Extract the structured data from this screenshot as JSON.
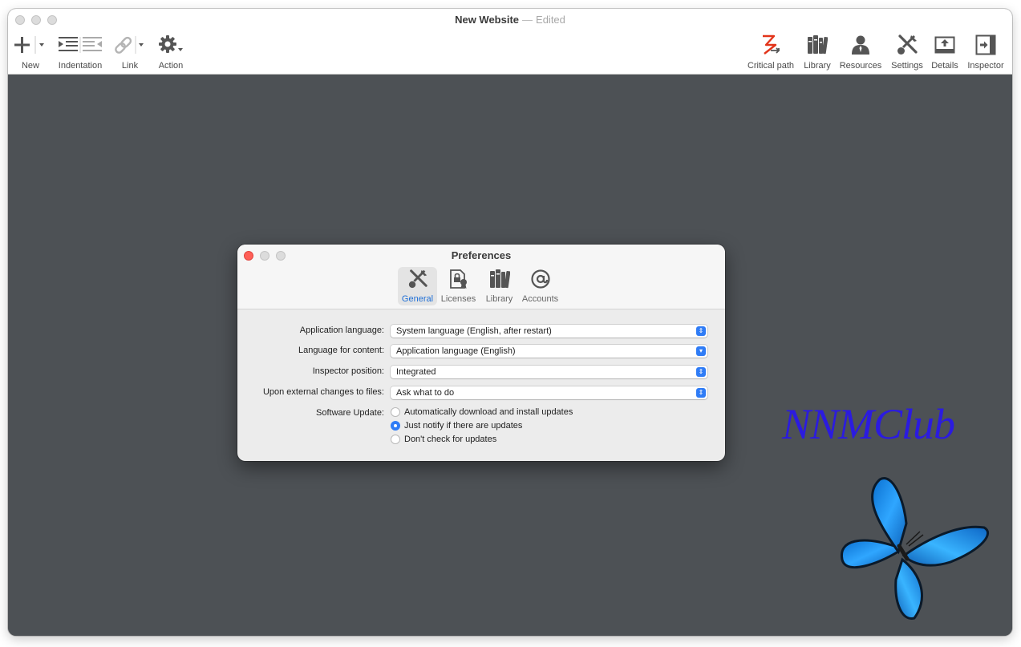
{
  "window": {
    "title": "New Website",
    "separator": "—",
    "status": "Edited"
  },
  "toolbar": {
    "left": [
      {
        "label": "New",
        "icon": "plus-icon"
      },
      {
        "label": "Indentation",
        "icon": "indentation-icon"
      },
      {
        "label": "Link",
        "icon": "link-icon"
      },
      {
        "label": "Action",
        "icon": "gear-icon"
      }
    ],
    "right": [
      {
        "label": "Critical path",
        "icon": "critical-path-icon"
      },
      {
        "label": "Library",
        "icon": "library-icon"
      },
      {
        "label": "Resources",
        "icon": "resources-icon"
      },
      {
        "label": "Settings",
        "icon": "settings-icon"
      },
      {
        "label": "Details",
        "icon": "details-icon"
      },
      {
        "label": "Inspector",
        "icon": "inspector-icon"
      }
    ]
  },
  "preferences": {
    "title": "Preferences",
    "tabs": [
      {
        "label": "General",
        "icon": "wrench-screwdriver-icon",
        "active": true
      },
      {
        "label": "Licenses",
        "icon": "license-icon",
        "active": false
      },
      {
        "label": "Library",
        "icon": "library-icon",
        "active": false
      },
      {
        "label": "Accounts",
        "icon": "at-sign-icon",
        "active": false
      }
    ],
    "fields": [
      {
        "label": "Application language:",
        "value": "System language (English, after restart)"
      },
      {
        "label": "Language for content:",
        "value": "Application language (English)"
      },
      {
        "label": "Inspector position:",
        "value": "Integrated"
      },
      {
        "label": "Upon external changes to files:",
        "value": "Ask what to do"
      }
    ],
    "software_update": {
      "label": "Software Update:",
      "options": [
        {
          "label": "Automatically download and install updates",
          "checked": false
        },
        {
          "label": "Just notify if there are updates",
          "checked": true
        },
        {
          "label": "Don't check for updates",
          "checked": false
        }
      ]
    }
  },
  "watermark": {
    "text": "NNMClub"
  },
  "colors": {
    "accent": "#2f7cf6",
    "background": "#4d5155",
    "close_button": "#fe5f57",
    "watermark": "#2b1be0"
  }
}
